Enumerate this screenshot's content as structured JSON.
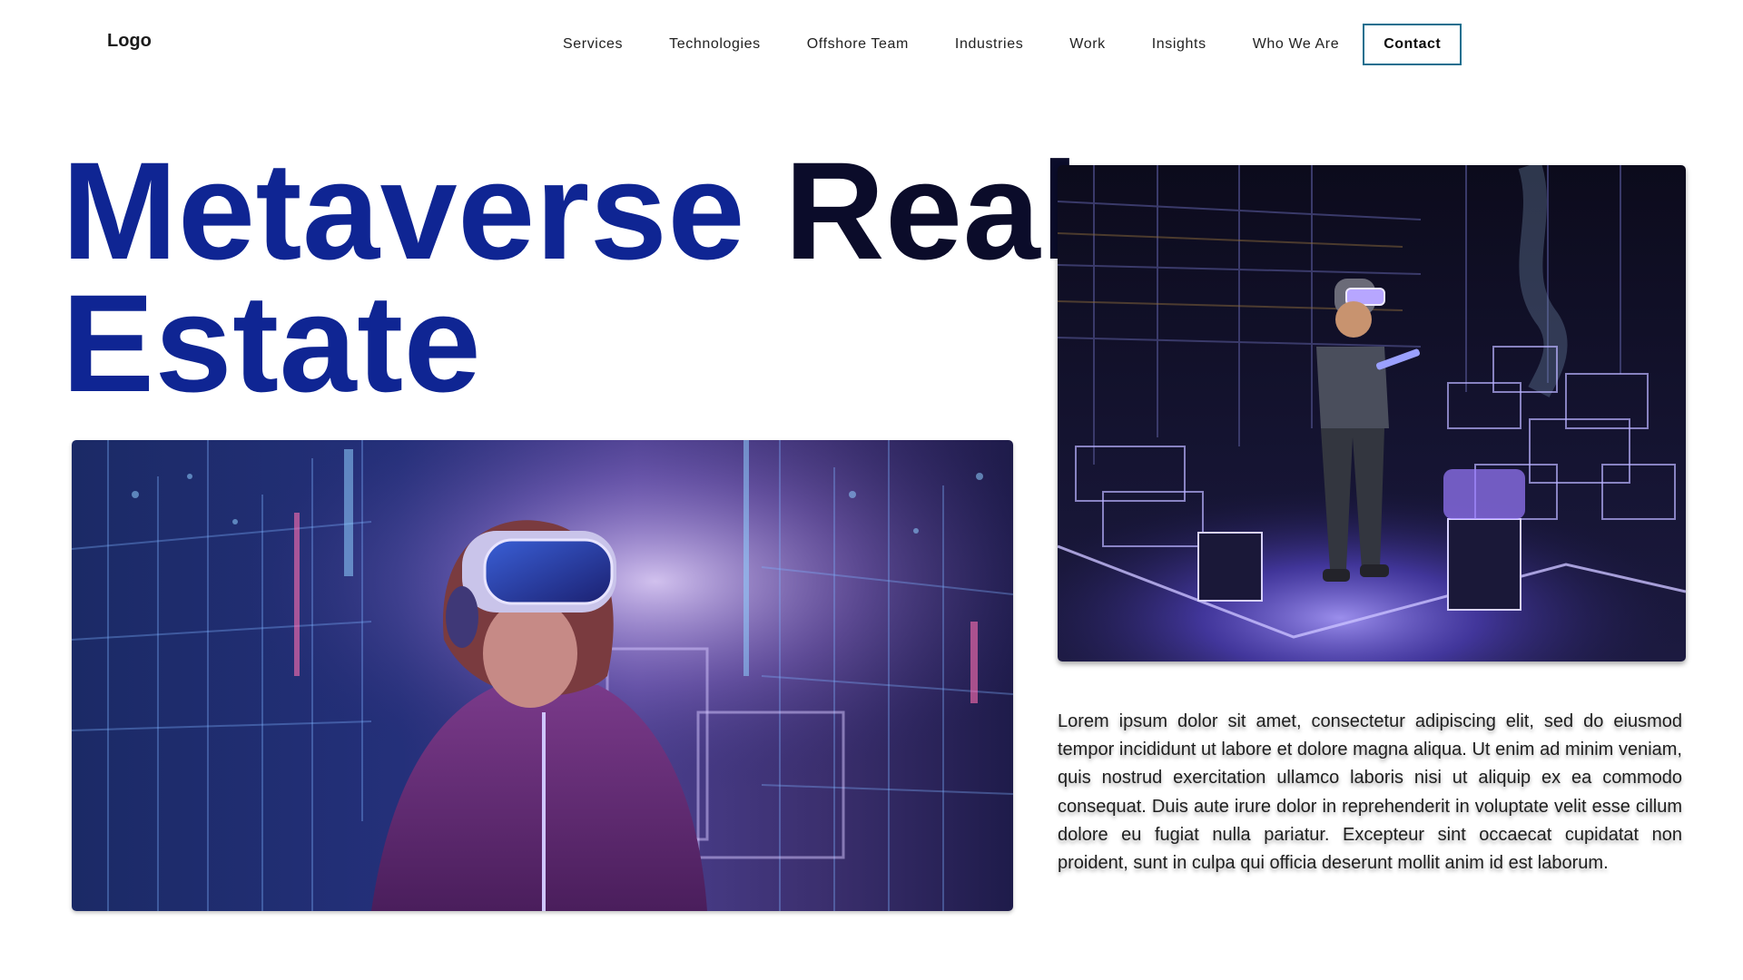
{
  "header": {
    "logo": "Logo",
    "nav": [
      {
        "label": "Services"
      },
      {
        "label": "Technologies"
      },
      {
        "label": "Offshore Team"
      },
      {
        "label": "Industries"
      },
      {
        "label": "Work"
      },
      {
        "label": "Insights"
      },
      {
        "label": "Who We Are"
      }
    ],
    "contact_label": "Contact"
  },
  "hero": {
    "title_word_1": "Metaverse",
    "title_word_2": "Real",
    "title_word_3": "Estate",
    "paragraph": "Lorem ipsum dolor sit amet, consectetur adipiscing elit, sed do eiusmod tempor incididunt ut labore et dolore magna aliqua. Ut enim ad minim veniam, quis nostrud exercitation ullamco laboris nisi ut aliquip ex ea commodo consequat. Duis aute irure dolor in reprehenderit in voluptate velit esse cillum dolore eu fugiat nulla pariatur. Excepteur sint occaecat cupidatat non proident, sunt in culpa qui officia deserunt mollit anim id est laborum."
  },
  "colors": {
    "title_blue": "#0f2593",
    "title_dark": "#0b0c2a",
    "contact_border": "#1a6f8f",
    "neon_purple": "#8a6cff"
  }
}
